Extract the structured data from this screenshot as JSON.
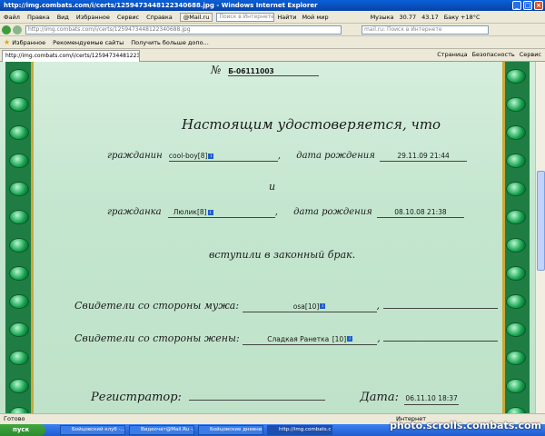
{
  "window": {
    "title": "http://img.combats.com/i/certs/1259473448122340688.jpg - Windows Internet Explorer"
  },
  "menu": {
    "items": [
      "Файл",
      "Правка",
      "Вид",
      "Избранное",
      "Сервис",
      "Справка"
    ],
    "mailru": "@Mail.ru",
    "search_placeholder": "Поиск в Интернете",
    "find_btn": "Найти",
    "myworld": "Мой мир",
    "music": "Музыка",
    "stats": [
      "30.77",
      "43.17"
    ],
    "weather": "Баку +18°C"
  },
  "address": {
    "url": "http://img.combats.com/i/certs/1259473448122340688.jpg",
    "search_placeholder": "mail.ru: Поиск в Интернете"
  },
  "favorites": {
    "label": "Избранное",
    "items": [
      "Рекомендуемые сайты",
      "Получить больше допо..."
    ]
  },
  "tab": {
    "label": "http://img.combats.com/i/certs/1259473448122340..."
  },
  "tools": {
    "page": "Страница",
    "safety": "Безопасность",
    "service": "Сервис"
  },
  "cert": {
    "number_label": "№",
    "number": "Б-06111003",
    "heading": "Настоящим удостоверяется, что",
    "citizen_m": "гражданин",
    "name_m": "cool-boy",
    "level_m": "[8]",
    "birth_label": "дата рождения",
    "birth_m": "29.11.09 21:44",
    "and": "и",
    "citizen_f": "гражданка",
    "name_f": "Люлик",
    "level_f": "[8]",
    "birth_f": "08.10.08 21:38",
    "married": "вступили в законный брак.",
    "witness_m_label": "Свидетели со стороны мужа:",
    "witness_m": "osa",
    "witness_m_level": "[10]",
    "witness_f_label": "Свидетели со стороны жены:",
    "witness_f": "Сладкая Ранетка",
    "witness_f_level": "[10]",
    "registrar_label": "Регистратор:",
    "date_label": "Дата:",
    "date": "06.11.10 18:37"
  },
  "status": {
    "text": "Готово",
    "zone": "Интернет"
  },
  "taskbar": {
    "start": "пуск",
    "items": [
      "Бойцовский клуб -...",
      "Видеочат@Mail.Ru -...",
      "Бойцовские дневни...",
      "http://img.combats.c..."
    ]
  },
  "watermark": "photo.scrolls.combats.com"
}
